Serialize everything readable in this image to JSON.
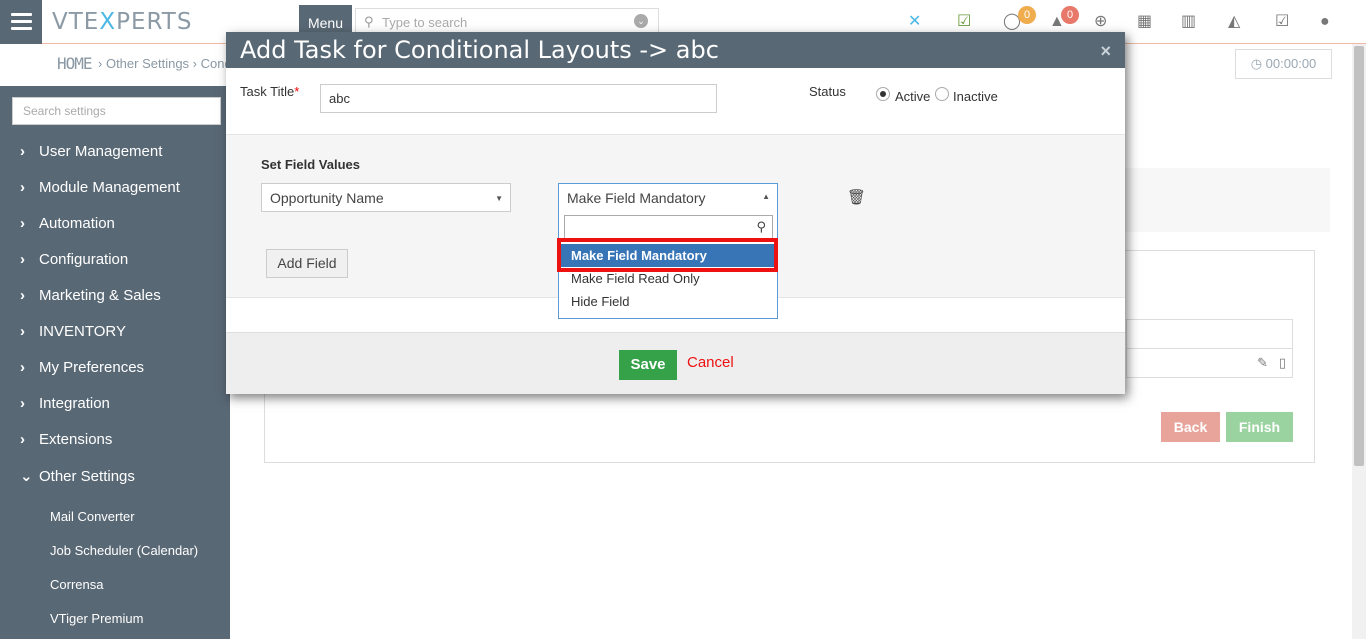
{
  "topbar": {
    "logo_left": "VTE",
    "logo_x": "X",
    "logo_right": "PERTS",
    "menu_label": "Menu",
    "search_placeholder": "Type to search",
    "chat_badge": "0",
    "notify_badge": "0"
  },
  "subheader": {
    "home": "HOME",
    "crumb_other": "Other Settings",
    "crumb_cond": "Cond",
    "timer": "00:00:00"
  },
  "sidebar": {
    "search_placeholder": "Search settings",
    "items": [
      {
        "label": "User Management",
        "chevron": "›"
      },
      {
        "label": "Module Management",
        "chevron": "›"
      },
      {
        "label": "Automation",
        "chevron": "›"
      },
      {
        "label": "Configuration",
        "chevron": "›"
      },
      {
        "label": "Marketing & Sales",
        "chevron": "›"
      },
      {
        "label": "INVENTORY",
        "chevron": "›"
      },
      {
        "label": "My Preferences",
        "chevron": "›"
      },
      {
        "label": "Integration",
        "chevron": "›"
      },
      {
        "label": "Extensions",
        "chevron": "›"
      },
      {
        "label": "Other Settings",
        "chevron": "⌄"
      }
    ],
    "sub_items": [
      "Mail Converter",
      "Job Scheduler (Calendar)",
      "Corrensa",
      "VTiger Premium"
    ]
  },
  "background": {
    "back_label": "Back",
    "finish_label": "Finish"
  },
  "modal": {
    "title": "Add Task for Conditional Layouts -> abc",
    "close": "×",
    "task_title_label": "Task Title",
    "required_mark": "*",
    "task_title_value": "abc",
    "status_label": "Status",
    "status_active": "Active",
    "status_inactive": "Inactive",
    "status_selected": "Active",
    "set_field_values_label": "Set Field Values",
    "field_select_value": "Opportunity Name",
    "action_select_value": "Make Field Mandatory",
    "add_field_label": "Add Field",
    "save_label": "Save",
    "cancel_label": "Cancel"
  },
  "dropdown": {
    "options": [
      "Make Field Mandatory",
      "Make Field Read Only",
      "Hide Field"
    ],
    "selected": "Make Field Mandatory"
  },
  "colors": {
    "sidebar_bg": "#596875",
    "modal_header_bg": "#596875",
    "save_green": "#35a24a",
    "cancel_red": "#ee1111",
    "dropdown_selected": "#3875b7",
    "highlight_red": "#ee1111"
  }
}
